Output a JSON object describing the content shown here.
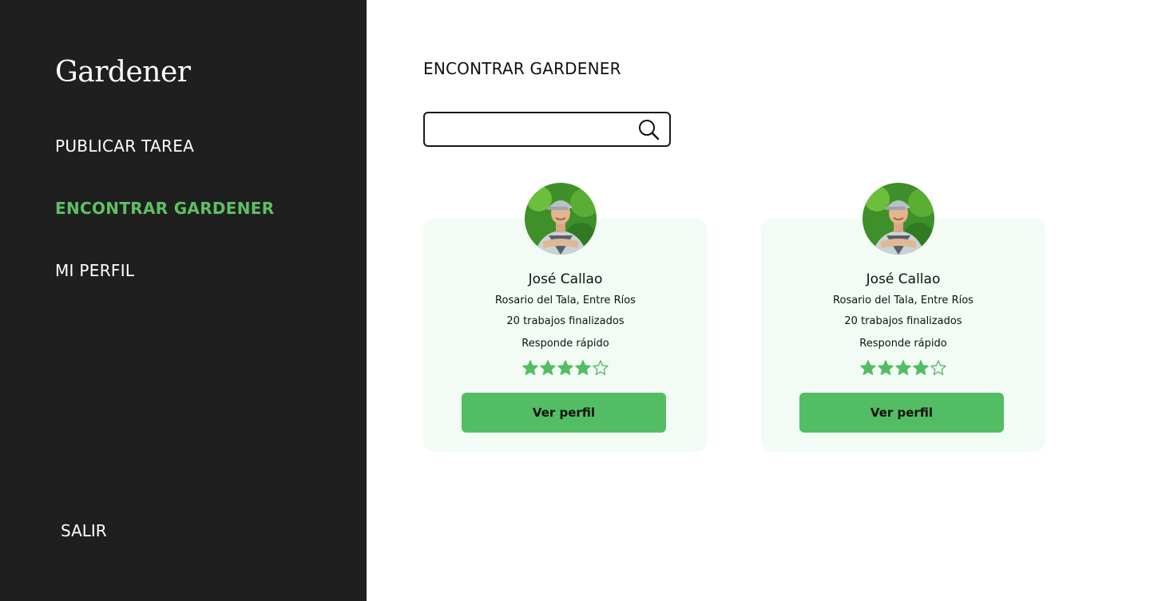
{
  "sidebar": {
    "logo": "Gardener",
    "nav": [
      {
        "label": "PUBLICAR TAREA"
      },
      {
        "label": "ENCONTRAR GARDENER"
      },
      {
        "label": "MI PERFIL"
      }
    ],
    "logout": "SALIR"
  },
  "main": {
    "title": "ENCONTRAR GARDENER",
    "search": {
      "value": "",
      "placeholder": ""
    },
    "cards": [
      {
        "name": "José Callao",
        "location": "Rosario del Tala, Entre Ríos",
        "jobs": "20 trabajos finalizados",
        "response": "Responde rápido",
        "rating": 4,
        "rating_max": 5,
        "button": "Ver perfil"
      },
      {
        "name": "José Callao",
        "location": "Rosario del Tala, Entre Ríos",
        "jobs": "20 trabajos finalizados",
        "response": "Responde rápido",
        "rating": 4,
        "rating_max": 5,
        "button": "Ver perfil"
      }
    ]
  },
  "colors": {
    "sidebar_bg": "#1f1f1f",
    "accent": "#53bd63",
    "card_bg": "#f3fbf5"
  }
}
